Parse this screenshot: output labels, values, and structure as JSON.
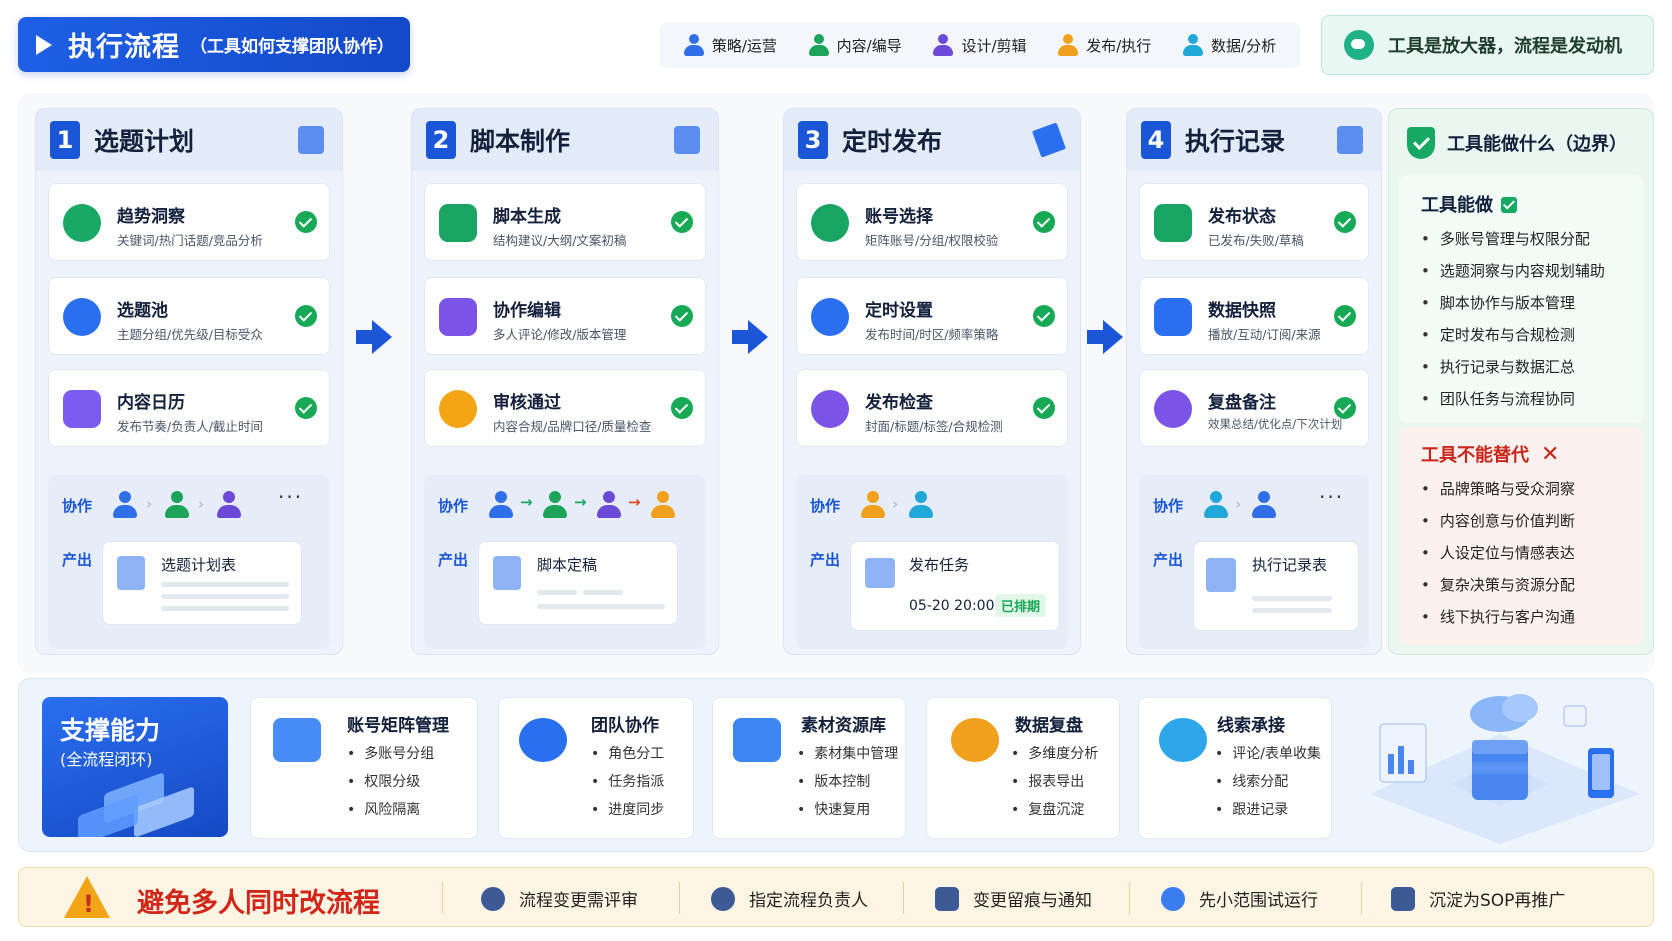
{
  "header": {
    "title": "执行流程",
    "subtitle": "（工具如何支撑团队协作）",
    "roles": [
      {
        "label": "策略/运营",
        "color": "#2f6fe8"
      },
      {
        "label": "内容/编导",
        "color": "#1ea35a"
      },
      {
        "label": "设计/剪辑",
        "color": "#6c4ad8"
      },
      {
        "label": "发布/执行",
        "color": "#f0a01c"
      },
      {
        "label": "数据/分析",
        "color": "#22a7d9"
      }
    ],
    "slogan": "工具是放大器，流程是发动机"
  },
  "steps": [
    {
      "num": "1",
      "title": "选题计划",
      "cards": [
        {
          "title": "趋势洞察",
          "desc": "关键词/热门话题/竞品分析",
          "icon": "target-icon",
          "color": "#1aa866"
        },
        {
          "title": "选题池",
          "desc": "主题分组/优先级/目标受众",
          "icon": "pie-icon",
          "color": "#2a6ff0"
        },
        {
          "title": "内容日历",
          "desc": "发布节奏/负责人/截止时间",
          "icon": "list-icon",
          "color": "#7a5cf0"
        }
      ],
      "collab_label": "协作",
      "output_label": "产出",
      "output": "选题计划表"
    },
    {
      "num": "2",
      "title": "脚本制作",
      "cards": [
        {
          "title": "脚本生成",
          "desc": "结构建议/大纲/文案初稿",
          "icon": "ai-icon",
          "color": "#19a463"
        },
        {
          "title": "协作编辑",
          "desc": "多人评论/修改/版本管理",
          "icon": "chat-icon",
          "color": "#7b53e6"
        },
        {
          "title": "审核通过",
          "desc": "内容合规/品牌口径/质量检查",
          "icon": "approve-icon",
          "color": "#f4a516"
        }
      ],
      "collab_label": "协作",
      "output_label": "产出",
      "output": "脚本定稿"
    },
    {
      "num": "3",
      "title": "定时发布",
      "cards": [
        {
          "title": "账号选择",
          "desc": "矩阵账号/分组/权限校验",
          "icon": "cloud-icon",
          "color": "#19a463"
        },
        {
          "title": "定时设置",
          "desc": "发布时间/时区/频率策略",
          "icon": "clock-icon",
          "color": "#2a6ff0"
        },
        {
          "title": "发布检查",
          "desc": "封面/标题/标签/合规检测",
          "icon": "upload-icon",
          "color": "#7b53e6"
        }
      ],
      "collab_label": "协作",
      "output_label": "产出",
      "output": "发布任务",
      "schedule_time": "05-20 20:00",
      "schedule_status": "已排期"
    },
    {
      "num": "4",
      "title": "执行记录",
      "cards": [
        {
          "title": "发布状态",
          "desc": "已发布/失败/草稿",
          "icon": "doc-icon",
          "color": "#19a463"
        },
        {
          "title": "数据快照",
          "desc": "播放/互动/订阅/来源",
          "icon": "bar-chart-icon",
          "color": "#2a6ff0"
        },
        {
          "title": "复盘备注",
          "desc": "效果总结/优化点/下次计划",
          "icon": "comment-icon",
          "color": "#7b53e6"
        }
      ],
      "collab_label": "协作",
      "output_label": "产出",
      "output": "执行记录表"
    }
  ],
  "boundary": {
    "title": "工具能做什么（边界）",
    "can_title": "工具能做",
    "can": [
      "多账号管理与权限分配",
      "选题洞察与内容规划辅助",
      "脚本协作与版本管理",
      "定时发布与合规检测",
      "执行记录与数据汇总",
      "团队任务与流程协同"
    ],
    "cannot_title": "工具不能替代",
    "cannot": [
      "品牌策略与受众洞察",
      "内容创意与价值判断",
      "人设定位与情感表达",
      "复杂决策与资源分配",
      "线下执行与客户沟通"
    ]
  },
  "support": {
    "title": "支撑能力",
    "subtitle": "(全流程闭环)",
    "items": [
      {
        "title": "账号矩阵管理",
        "points": [
          "多账号分组",
          "权限分级",
          "风险隔离"
        ],
        "icon": "folder-user-icon",
        "color": "#4a8cf5"
      },
      {
        "title": "团队协作",
        "points": [
          "角色分工",
          "任务指派",
          "进度同步"
        ],
        "icon": "team-icon",
        "color": "#2a6ff0"
      },
      {
        "title": "素材资源库",
        "points": [
          "素材集中管理",
          "版本控制",
          "快速复用"
        ],
        "icon": "video-folder-icon",
        "color": "#3c86f2"
      },
      {
        "title": "数据复盘",
        "points": [
          "多维度分析",
          "报表导出",
          "复盘沉淀"
        ],
        "icon": "pie-chart-icon",
        "color": "#f0a01c"
      },
      {
        "title": "线索承接",
        "points": [
          "评论/表单收集",
          "线索分配",
          "跟进记录"
        ],
        "icon": "users-icon",
        "color": "#2fa6e8"
      }
    ]
  },
  "warning": {
    "title": "避免多人同时改流程",
    "items": [
      {
        "label": "流程变更需评审",
        "icon": "group-icon"
      },
      {
        "label": "指定流程负责人",
        "icon": "person-icon"
      },
      {
        "label": "变更留痕与通知",
        "icon": "doc-edit-icon"
      },
      {
        "label": "先小范围试运行",
        "icon": "play-circle-icon"
      },
      {
        "label": "沉淀为SOP再推广",
        "icon": "checklist-icon"
      }
    ]
  }
}
